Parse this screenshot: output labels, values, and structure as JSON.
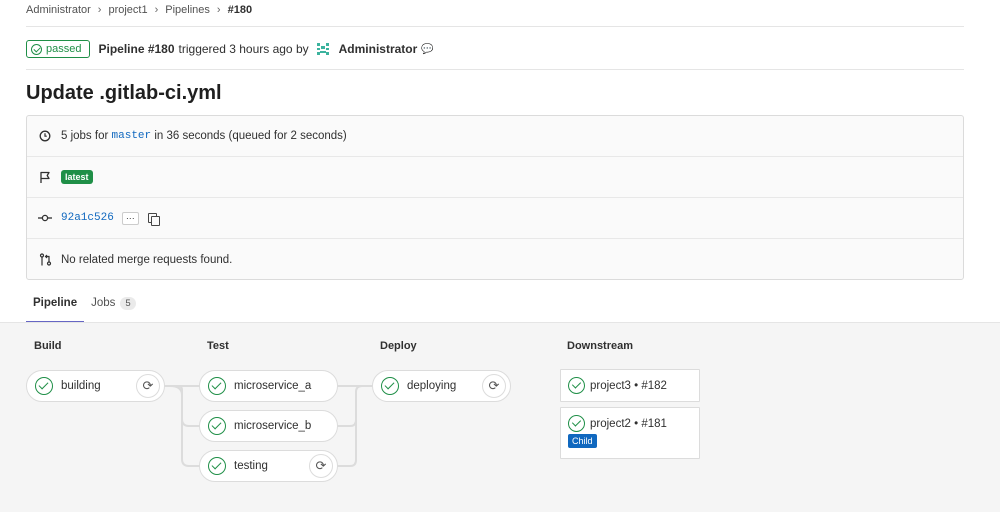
{
  "breadcrumb": [
    "Administrator",
    "project1",
    "Pipelines",
    "#180"
  ],
  "header": {
    "status": "passed",
    "pipeline_label": "Pipeline #180",
    "triggered_text": "triggered 3 hours ago by",
    "author": "Administrator"
  },
  "commit_title": "Update .gitlab-ci.yml",
  "info": {
    "jobs_prefix": "5 jobs for",
    "branch": "master",
    "duration_text": "in 36 seconds (queued for 2 seconds)",
    "tag": "latest",
    "sha": "92a1c526",
    "ellipsis": "···",
    "merge_requests": "No related merge requests found."
  },
  "tabs": [
    {
      "label": "Pipeline",
      "active": true
    },
    {
      "label": "Jobs",
      "count": "5",
      "active": false
    }
  ],
  "stages": [
    {
      "name": "Build",
      "jobs": [
        "building"
      ]
    },
    {
      "name": "Test",
      "jobs": [
        "microservice_a",
        "microservice_b",
        "testing"
      ]
    },
    {
      "name": "Deploy",
      "jobs": [
        "deploying"
      ]
    }
  ],
  "downstream": {
    "title": "Downstream",
    "pipelines": [
      {
        "project": "project3",
        "id": "#182",
        "separator": "•"
      },
      {
        "project": "project2",
        "id": "#181",
        "separator": "•",
        "badge": "Child"
      }
    ]
  },
  "colors": {
    "success": "#1f8f47",
    "link": "#1068bf",
    "tab_active": "#6666c4"
  }
}
